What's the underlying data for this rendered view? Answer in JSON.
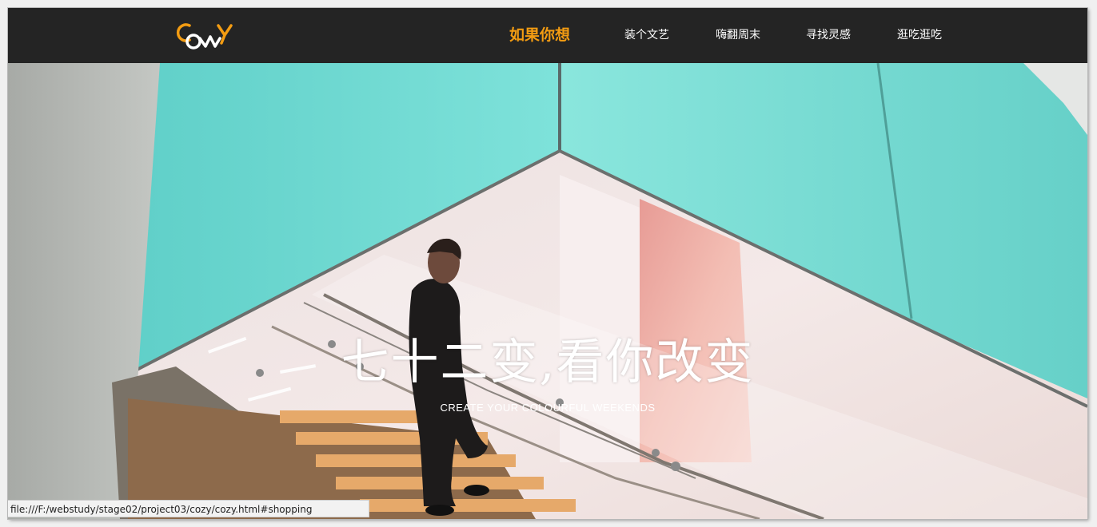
{
  "header": {
    "logo_text": "COZY",
    "nav": [
      {
        "label": "如果你想",
        "active": true
      },
      {
        "label": "装个文艺",
        "active": false
      },
      {
        "label": "嗨翻周末",
        "active": false
      },
      {
        "label": "寻找灵感",
        "active": false
      },
      {
        "label": "逛吃逛吃",
        "active": false
      }
    ]
  },
  "hero": {
    "title": "七十二变,看你改变",
    "subtitle": "CREATE YOUR COLOURFUL WEEKENDS",
    "image_description": "man-walking-up-staircase"
  },
  "status_bar": {
    "url": "file:///F:/webstudy/stage02/project03/cozy/cozy.html#shopping"
  },
  "colors": {
    "topbar": "#242424",
    "accent": "#f39c12",
    "text": "#ffffff"
  }
}
